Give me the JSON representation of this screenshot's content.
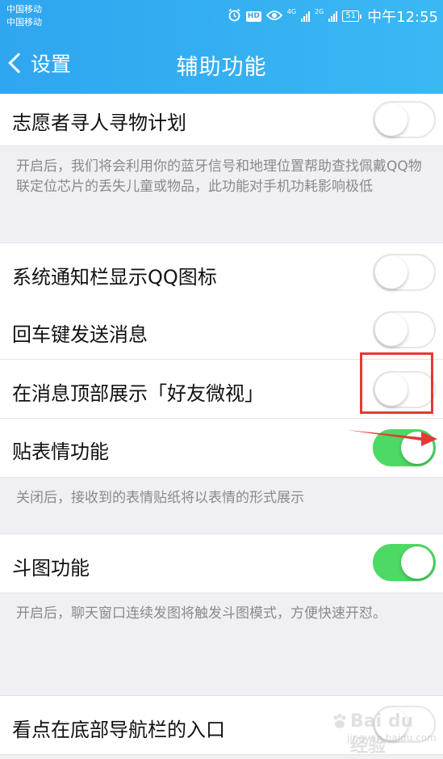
{
  "status_bar": {
    "carrier_1": "中国移动",
    "carrier_2": "中国移动",
    "hd_badge": "HD",
    "network_1": "4G",
    "network_2": "2G",
    "battery": "51",
    "time": "中午12:55",
    "icons": [
      "alarm-icon",
      "eye-icon",
      "signal-icon",
      "battery-icon"
    ]
  },
  "header": {
    "back_label": "设置",
    "title": "辅助功能"
  },
  "settings": [
    {
      "label": "志愿者寻人寻物计划",
      "toggle": "off",
      "description": "开启后，我们将会利用你的蓝牙信号和地理位置帮助查找佩戴QQ物联定位芯片的丢失儿童或物品，此功能对手机功耗影响极低"
    },
    {
      "label": "系统通知栏显示QQ图标",
      "toggle": "off"
    },
    {
      "label": "回车键发送消息",
      "toggle": "off"
    },
    {
      "label": "在消息顶部展示「好友微视」",
      "toggle": "off"
    },
    {
      "label": "贴表情功能",
      "toggle": "on",
      "description": "关闭后，接收到的表情贴纸将以表情的形式展示"
    },
    {
      "label": "斗图功能",
      "toggle": "on",
      "description": "开启后，聊天窗口连续发图将触发斗图模式，方便快速开怼。"
    },
    {
      "label": "看点在底部导航栏的入口",
      "toggle": "off"
    }
  ],
  "annotations": {
    "highlight_color": "#e53935",
    "arrow_color": "#e53935"
  },
  "watermark": {
    "brand": "Bai du 经验",
    "url": "jingyan.baidu.com"
  },
  "colors": {
    "header_blue": "#2fa6f0",
    "toggle_on": "#4cd964",
    "background": "#efeff4"
  }
}
